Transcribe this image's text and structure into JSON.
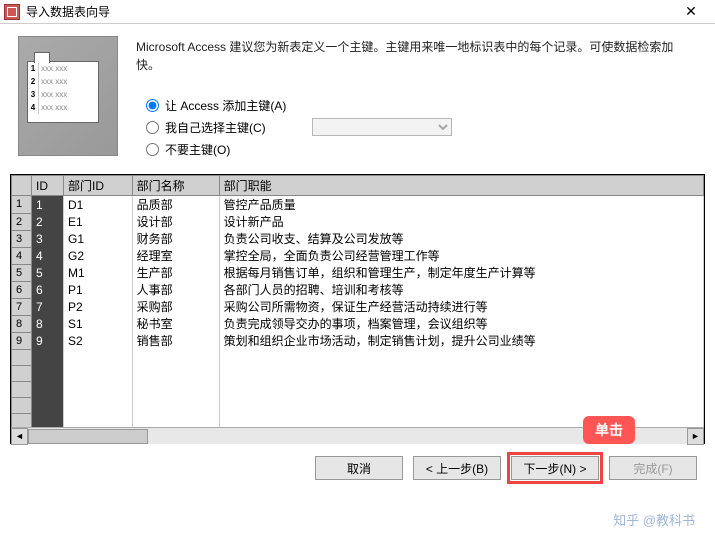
{
  "window": {
    "title": "导入数据表向导",
    "close": "✕"
  },
  "description": "Microsoft Access 建议您为新表定义一个主键。主键用来唯一地标识表中的每个记录。可使数据检索加快。",
  "radios": {
    "opt1": "让 Access 添加主键(A)",
    "opt2": "我自己选择主键(C)",
    "opt3": "不要主键(O)"
  },
  "columns": [
    "ID",
    "部门ID",
    "部门名称",
    "部门职能"
  ],
  "rows": [
    {
      "n": "1",
      "id": "1",
      "dept": "D1",
      "name": "品质部",
      "func": "管控产品质量"
    },
    {
      "n": "2",
      "id": "2",
      "dept": "E1",
      "name": "设计部",
      "func": "设计新产品"
    },
    {
      "n": "3",
      "id": "3",
      "dept": "G1",
      "name": "财务部",
      "func": "负责公司收支、结算及公司发放等"
    },
    {
      "n": "4",
      "id": "4",
      "dept": "G2",
      "name": "经理室",
      "func": "掌控全局，全面负责公司经营管理工作等"
    },
    {
      "n": "5",
      "id": "5",
      "dept": "M1",
      "name": "生产部",
      "func": "根据每月销售订单，组织和管理生产，制定年度生产计算等"
    },
    {
      "n": "6",
      "id": "6",
      "dept": "P1",
      "name": "人事部",
      "func": "各部门人员的招聘、培训和考核等"
    },
    {
      "n": "7",
      "id": "7",
      "dept": "P2",
      "name": "采购部",
      "func": "采购公司所需物资，保证生产经营活动持续进行等"
    },
    {
      "n": "8",
      "id": "8",
      "dept": "S1",
      "name": "秘书室",
      "func": "负责完成领导交办的事项，档案管理，会议组织等"
    },
    {
      "n": "9",
      "id": "9",
      "dept": "S2",
      "name": "销售部",
      "func": "策划和组织企业市场活动，制定销售计划，提升公司业绩等"
    }
  ],
  "buttons": {
    "cancel": "取消",
    "back": "< 上一步(B)",
    "next": "下一步(N) >",
    "finish": "完成(F)"
  },
  "callout": "单击",
  "watermark": "知乎 @教科书"
}
